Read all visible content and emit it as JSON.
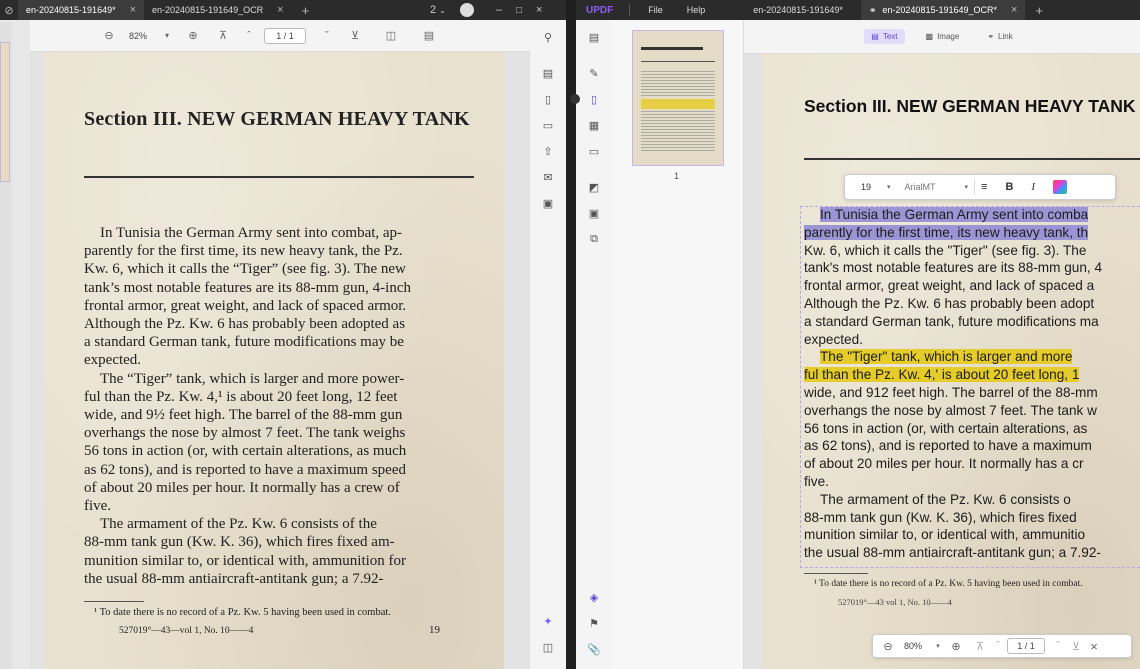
{
  "left": {
    "tabs": [
      {
        "label": "en-20240815-191649*",
        "active": true
      },
      {
        "label": "en-20240815-191649_OCR",
        "active": false
      }
    ],
    "tab_count": "2",
    "zoom": "82%",
    "page_indicator": "1 / 1",
    "page": {
      "title": "Section III. NEW GERMAN HEAVY TANK",
      "lines": [
        "In Tunisia the German Army sent into combat, ap-",
        "parently for the first time, its new heavy tank, the Pz.",
        "Kw. 6, which it calls the “Tiger” (see fig. 3).  The new",
        "tank’s most notable features are its 88-mm gun, 4-inch",
        "frontal armor, great weight, and lack of spaced armor.",
        "Although the Pz. Kw. 6 has probably been adopted as",
        "a standard German tank, future modifications may be",
        "expected.",
        "The “Tiger” tank, which is larger and more power-",
        "ful than the Pz. Kw. 4,¹ is about 20 feet long, 12 feet",
        "wide, and 9½ feet high.  The barrel of the 88-mm gun",
        "overhangs the nose by almost 7 feet.  The tank weighs",
        "56 tons in action (or, with certain alterations, as much",
        "as 62 tons), and is reported to have a maximum speed",
        "of about 20 miles per hour.  It normally has a crew of",
        "five.",
        "The armament of the Pz. Kw. 6 consists of the",
        "88-mm tank gun (Kw. K. 36), which fires fixed am-",
        "munition similar to, or identical with, ammunition for",
        "the usual 88-mm antiaircraft-antitank gun; a 7.92-"
      ],
      "footnote": "¹ To date there is no record of a Pz. Kw. 5 having been used in combat.",
      "print_line": "527019°—43—vol 1, No. 10——4",
      "page_number": "19"
    }
  },
  "right": {
    "app_name": "UPDF",
    "menu": [
      "File",
      "Help"
    ],
    "tabs": [
      {
        "label": "en-20240815-191649*",
        "active": false
      },
      {
        "label": "en-20240815-191649_OCR*",
        "active": true
      }
    ],
    "edit_modes": [
      "Text",
      "Image",
      "Link"
    ],
    "thumb_page_num": "1",
    "format": {
      "font_size": "19",
      "font_name": "ArialMT",
      "bold": "B",
      "italic": "I"
    },
    "page": {
      "title": "Section III. NEW GERMAN HEAVY TANK",
      "lines": [
        "In Tunisia the German Army sent into comba",
        "parently for the first time, its new heavy tank, th",
        "Kw. 6, which it calls the \"Tiger\" (see fig. 3). The",
        "tank's most notable features are its 88-mm gun, 4",
        "frontal armor, great weight, and lack of spaced a",
        "Although the Pz. Kw. 6 has probably been adopt",
        "a standard German tank, future modifications ma",
        "expected.",
        "The \"Tiger\" tank, which is larger and more",
        "ful than the Pz. Kw. 4,' is about 20 feet long, 1",
        "wide, and 912 feet high. The barrel of the 88-mm",
        "overhangs the nose by almost 7 feet. The tank w",
        "56 tons in action (or, with certain alterations, as",
        "as 62 tons), and is reported to have a maximum",
        "of about 20 miles per hour. It normally has a cr",
        "five.",
        "The armament of the Pz. Kw. 6 consists o",
        "88-mm tank gun (Kw. K. 36), which fires fixed",
        "munition similar to, or identical with, ammunitio",
        "the usual 88-mm antiaircraft-antitank gun; a 7.92-"
      ],
      "footnote": "¹ To date there is no record of a Pz. Kw. 5 having been used in combat.",
      "print_line": "527019°—43 vol 1, No. 10——4"
    },
    "zoom": "80%",
    "page_indicator": "1 / 1"
  },
  "colors": {
    "accent": "#5a47d6",
    "highlight_blue": "#9b95d6",
    "highlight_yellow": "#e6cc2a",
    "paper": "#e9e1cf"
  }
}
